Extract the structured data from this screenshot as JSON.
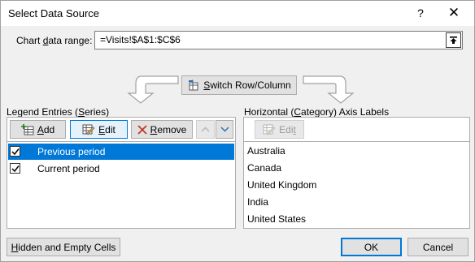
{
  "window": {
    "title": "Select Data Source",
    "help_glyph": "?",
    "close_glyph": "✕"
  },
  "range": {
    "label": "Chart data range:",
    "value": "=Visits!$A$1:$C$6"
  },
  "switch_button": {
    "label": "Switch Row/Column"
  },
  "legend": {
    "label": "Legend Entries (Series)",
    "add_label": "Add",
    "edit_label": "Edit",
    "remove_label": "Remove",
    "series": [
      {
        "name": "Previous period",
        "checked": true,
        "selected": true
      },
      {
        "name": "Current period",
        "checked": true,
        "selected": false
      }
    ]
  },
  "axis": {
    "label": "Horizontal (Category) Axis Labels",
    "edit_label": "Edit",
    "categories": [
      "Australia",
      "Canada",
      "United Kingdom",
      "India",
      "United States"
    ]
  },
  "footer": {
    "hidden_empty_label": "Hidden and Empty Cells",
    "ok_label": "OK",
    "cancel_label": "Cancel"
  },
  "colors": {
    "selection": "#0078d7",
    "remove_icon": "#c0392b"
  }
}
